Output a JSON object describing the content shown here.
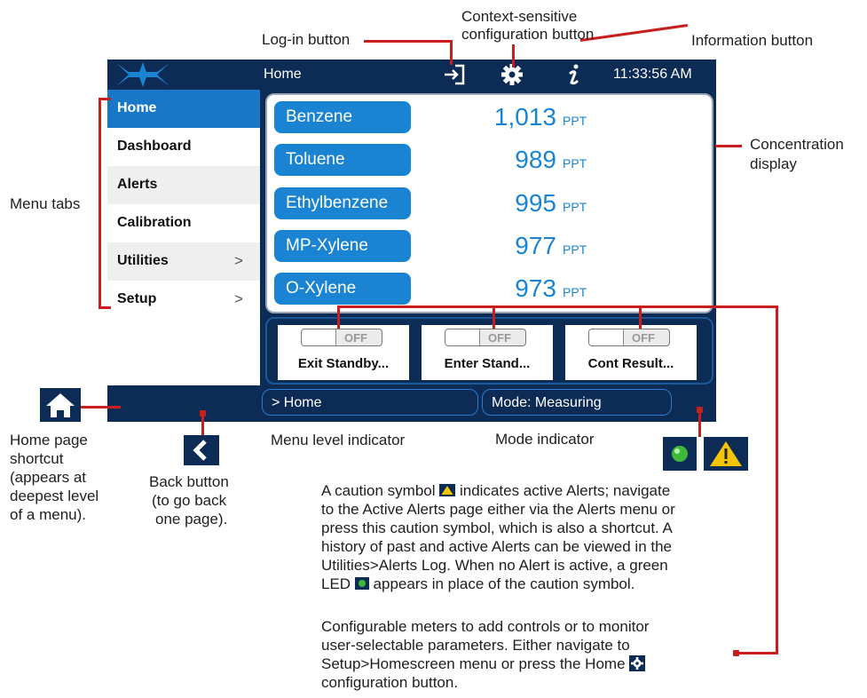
{
  "annotations": {
    "login": "Log-in button",
    "config_line1": "Context-sensitive",
    "config_line2": "configuration button",
    "info": "Information button",
    "concentration_line1": "Concentration",
    "concentration_line2": "display",
    "menu_tabs": "Menu tabs",
    "home_shortcut": [
      "Home page",
      "shortcut",
      "(appears at",
      "deepest level",
      "of a menu)."
    ],
    "back_button": [
      "Back button",
      "(to go back",
      "one page)."
    ],
    "menu_level": "Menu level indicator",
    "mode": "Mode indicator",
    "caution_para": [
      "A caution symbol",
      "indicates active Alerts; navigate",
      "to the Active Alerts page either via the Alerts menu or",
      "press this caution symbol, which is also a shortcut. A",
      "history of past and active Alerts can be viewed in the",
      "Utilities>Alerts Log. When no Alert is active, a green",
      "LED",
      "appears in place of the caution symbol."
    ],
    "config_para": [
      "Configurable meters to add controls or to monitor",
      "user-selectable parameters. Either navigate to",
      "Setup>Homescreen menu or press the Home",
      "configuration button."
    ]
  },
  "screen": {
    "title": "Home",
    "clock": "11:33:56 AM",
    "menu": [
      {
        "label": "Home",
        "active": true,
        "chevron": ""
      },
      {
        "label": "Dashboard",
        "active": false,
        "chevron": ""
      },
      {
        "label": "Alerts",
        "active": false,
        "chevron": ""
      },
      {
        "label": "Calibration",
        "active": false,
        "chevron": ""
      },
      {
        "label": "Utilities",
        "active": false,
        "chevron": ">"
      },
      {
        "label": "Setup",
        "active": false,
        "chevron": ">"
      }
    ],
    "gases": [
      {
        "name": "Benzene",
        "value": "1,013",
        "unit": "PPT"
      },
      {
        "name": "Toluene",
        "value": "989",
        "unit": "PPT"
      },
      {
        "name": "Ethylbenzene",
        "value": "995",
        "unit": "PPT"
      },
      {
        "name": "MP-Xylene",
        "value": "977",
        "unit": "PPT"
      },
      {
        "name": "O-Xylene",
        "value": "973",
        "unit": "PPT"
      }
    ],
    "meters": [
      {
        "state": "OFF",
        "label": "Exit Standby..."
      },
      {
        "state": "OFF",
        "label": "Enter Stand..."
      },
      {
        "state": "OFF",
        "label": "Cont Result..."
      }
    ],
    "breadcrumb": "> Home",
    "mode": "Mode: Measuring"
  },
  "colors": {
    "screen_bg": "#0c2b55",
    "accent_blue": "#1a84d2",
    "active_tab": "#1878c7",
    "annotation_red": "#c81e1e",
    "led_green": "#3fb93a",
    "caution_yellow": "#f5c400"
  },
  "icons": [
    "login-icon",
    "gear-icon",
    "info-icon",
    "home-icon",
    "back-icon",
    "green-led-icon",
    "caution-icon"
  ]
}
